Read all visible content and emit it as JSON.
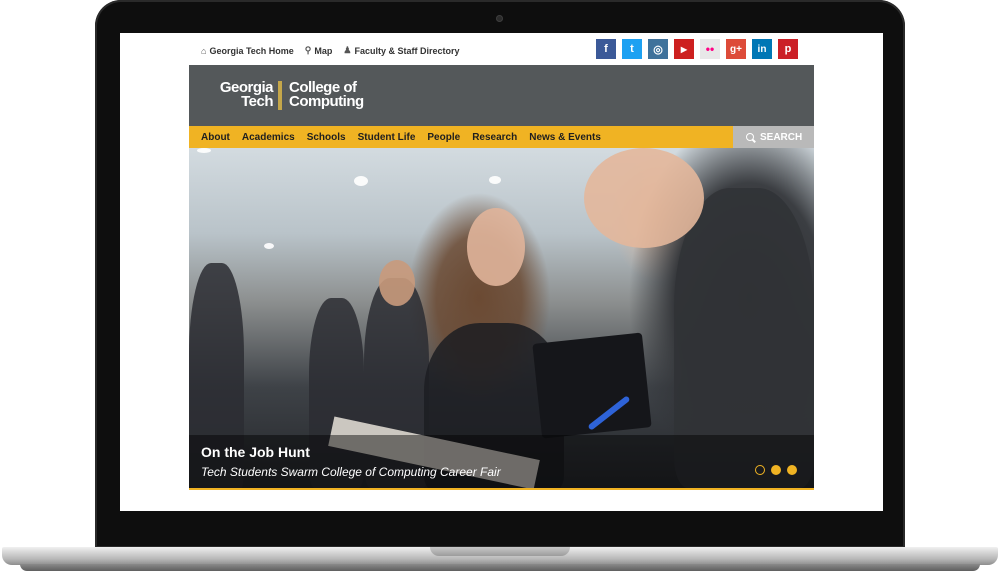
{
  "utility": {
    "links": [
      {
        "label": "Georgia Tech Home",
        "icon": "home-icon"
      },
      {
        "label": "Map",
        "icon": "map-pin-icon"
      },
      {
        "label": "Faculty & Staff Directory",
        "icon": "person-icon"
      }
    ]
  },
  "social": [
    {
      "name": "facebook-icon",
      "glyph": "f",
      "color": "#3b5998"
    },
    {
      "name": "twitter-icon",
      "glyph": "t",
      "color": "#1da1f2"
    },
    {
      "name": "instagram-icon",
      "glyph": "◎",
      "color": "#3f729b"
    },
    {
      "name": "youtube-icon",
      "glyph": "▶",
      "color": "#cd201f"
    },
    {
      "name": "flickr-icon",
      "glyph": "••",
      "color": "#e8e8e8"
    },
    {
      "name": "google-plus-icon",
      "glyph": "g+",
      "color": "#dd4b39"
    },
    {
      "name": "linkedin-icon",
      "glyph": "in",
      "color": "#0077b5"
    },
    {
      "name": "pinterest-icon",
      "glyph": "p",
      "color": "#cb2027"
    }
  ],
  "header": {
    "logo_line1": "Georgia",
    "logo_line2": "Tech",
    "logo_line3": "College of",
    "logo_line4": "Computing"
  },
  "nav": {
    "items": [
      "About",
      "Academics",
      "Schools",
      "Student Life",
      "People",
      "Research",
      "News & Events"
    ],
    "search_label": "SEARCH"
  },
  "hero": {
    "title": "On the Job Hunt",
    "subtitle": "Tech Students Swarm College of Computing Career Fair",
    "slides_total": 3,
    "active_slide": 1
  },
  "colors": {
    "accent": "#f0b323",
    "header_bg": "#54585a",
    "search_bg": "#b9b9b9"
  }
}
